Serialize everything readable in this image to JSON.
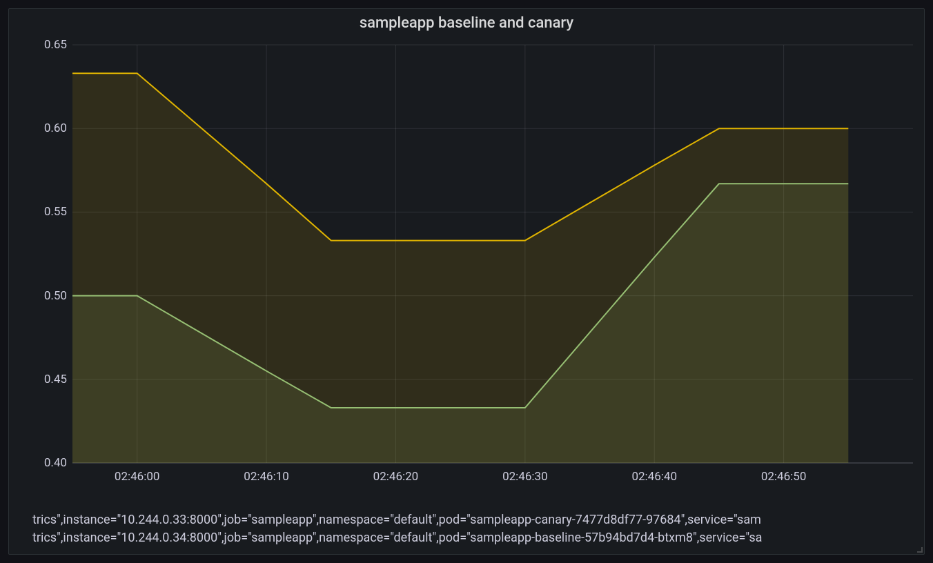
{
  "title": "sampleapp baseline and canary",
  "chart_data": {
    "type": "area",
    "x": [
      "02:45:55",
      "02:46:00",
      "02:46:10",
      "02:46:15",
      "02:46:30",
      "02:46:40",
      "02:46:45",
      "02:46:55"
    ],
    "series": [
      {
        "name": "canary",
        "color": "#e0b400",
        "legend": "trics\",instance=\"10.244.0.33:8000\",job=\"sampleapp\",namespace=\"default\",pod=\"sampleapp-canary-7477d8df77-97684\",service=\"sam",
        "values": [
          0.633,
          0.633,
          0.567,
          0.533,
          0.533,
          0.578,
          0.6,
          0.6
        ]
      },
      {
        "name": "baseline",
        "color": "#96bf73",
        "legend": "trics\",instance=\"10.244.0.34:8000\",job=\"sampleapp\",namespace=\"default\",pod=\"sampleapp-baseline-57b94bd7d4-btxm8\",service=\"sa",
        "values": [
          0.5,
          0.5,
          0.455,
          0.433,
          0.433,
          0.523,
          0.567,
          0.567
        ]
      }
    ],
    "y_ticks": [
      0.4,
      0.45,
      0.5,
      0.55,
      0.6,
      0.65
    ],
    "y_tick_labels": [
      "0.40",
      "0.45",
      "0.50",
      "0.55",
      "0.60",
      "0.65"
    ],
    "ylim": [
      0.4,
      0.65
    ],
    "x_ticks": [
      "02:46:00",
      "02:46:10",
      "02:46:20",
      "02:46:30",
      "02:46:40",
      "02:46:50"
    ],
    "x_range_seconds": [
      -5,
      60
    ],
    "x_seconds": [
      -5,
      0,
      10,
      15,
      30,
      40,
      45,
      55
    ],
    "x_tick_seconds": [
      0,
      10,
      20,
      30,
      40,
      50
    ],
    "title": "sampleapp baseline and canary",
    "grid": true,
    "fill_opacity": 0.12
  }
}
